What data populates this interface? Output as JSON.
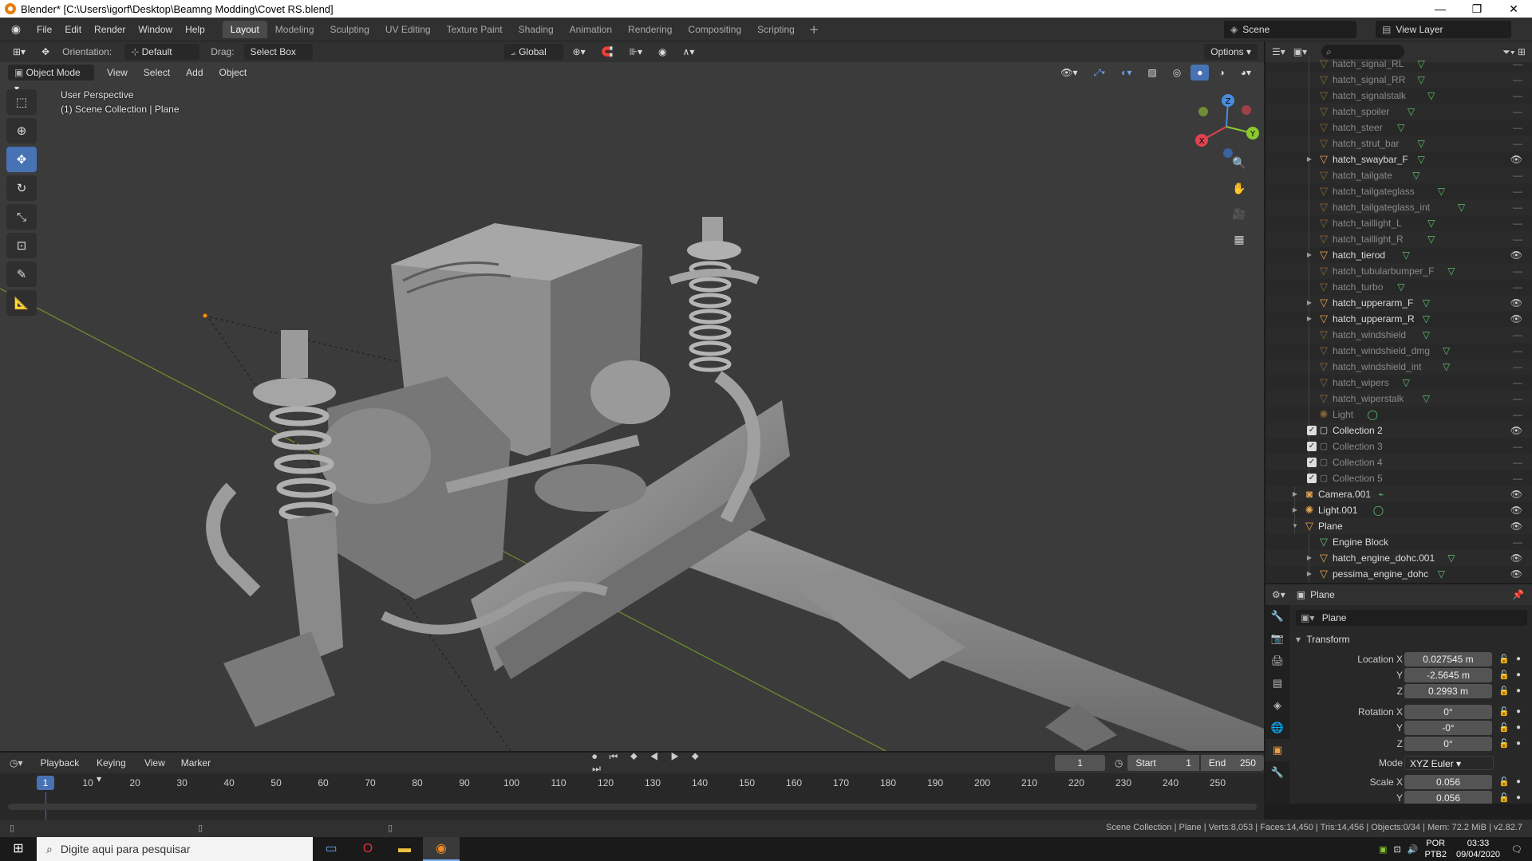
{
  "window": {
    "title": "Blender* [C:\\Users\\igorf\\Desktop\\Beamng Modding\\Covet RS.blend]",
    "controls": [
      "—",
      "❐",
      "✕"
    ]
  },
  "menu": {
    "items": [
      "File",
      "Edit",
      "Render",
      "Window",
      "Help"
    ]
  },
  "workspaces": {
    "tabs": [
      "Layout",
      "Modeling",
      "Sculpting",
      "UV Editing",
      "Texture Paint",
      "Shading",
      "Animation",
      "Rendering",
      "Compositing",
      "Scripting"
    ],
    "active": "Layout"
  },
  "scene": {
    "name": "Scene",
    "view_layer": "View Layer"
  },
  "viewport": {
    "orientation_label": "Orientation:",
    "orientation_value": "Default",
    "drag_label": "Drag:",
    "drag_value": "Select Box",
    "transform_orientation": "Global",
    "options_label": "Options",
    "mode": "Object Mode",
    "menus": [
      "View",
      "Select",
      "Add",
      "Object"
    ],
    "info_line1": "User Perspective",
    "info_line2": "(1) Scene Collection | Plane",
    "gizmo_axes": {
      "x": "X",
      "y": "Y",
      "z": "Z"
    },
    "axis_colors": {
      "x": "#e0434f",
      "y": "#8cc832",
      "z": "#4a8be0",
      "grid_line": "#6b8a2e"
    }
  },
  "outliner": {
    "rows": [
      {
        "name": "hatch_signal_RL",
        "dim": true,
        "eye": false,
        "expandable": false,
        "data": "▽"
      },
      {
        "name": "hatch_signal_RR",
        "dim": true,
        "eye": false,
        "expandable": false,
        "data": "▽"
      },
      {
        "name": "hatch_signalstalk",
        "dim": true,
        "eye": false,
        "expandable": false,
        "data": "▽"
      },
      {
        "name": "hatch_spoiler",
        "dim": true,
        "eye": false,
        "expandable": false,
        "data": "▽"
      },
      {
        "name": "hatch_steer",
        "dim": true,
        "eye": false,
        "expandable": false,
        "data": "▽"
      },
      {
        "name": "hatch_strut_bar",
        "dim": true,
        "eye": false,
        "expandable": false,
        "data": "▽"
      },
      {
        "name": "hatch_swaybar_F",
        "dim": false,
        "eye": true,
        "expandable": true,
        "data": "▽"
      },
      {
        "name": "hatch_tailgate",
        "dim": true,
        "eye": false,
        "expandable": false,
        "data": "▽"
      },
      {
        "name": "hatch_tailgateglass",
        "dim": true,
        "eye": false,
        "expandable": false,
        "data": "▽"
      },
      {
        "name": "hatch_tailgateglass_int",
        "dim": true,
        "eye": false,
        "expandable": false,
        "data": "▽"
      },
      {
        "name": "hatch_taillight_L",
        "dim": true,
        "eye": false,
        "expandable": false,
        "data": "▽"
      },
      {
        "name": "hatch_taillight_R",
        "dim": true,
        "eye": false,
        "expandable": false,
        "data": "▽"
      },
      {
        "name": "hatch_tierod",
        "dim": false,
        "eye": true,
        "expandable": true,
        "data": "▽"
      },
      {
        "name": "hatch_tubularbumper_F",
        "dim": true,
        "eye": false,
        "expandable": false,
        "data": "▽"
      },
      {
        "name": "hatch_turbo",
        "dim": true,
        "eye": false,
        "expandable": false,
        "data": "▽"
      },
      {
        "name": "hatch_upperarm_F",
        "dim": false,
        "eye": true,
        "expandable": true,
        "data": "▽"
      },
      {
        "name": "hatch_upperarm_R",
        "dim": false,
        "eye": true,
        "expandable": true,
        "data": "▽"
      },
      {
        "name": "hatch_windshield",
        "dim": true,
        "eye": false,
        "expandable": false,
        "data": "▽"
      },
      {
        "name": "hatch_windshield_dmg",
        "dim": true,
        "eye": false,
        "expandable": false,
        "data": "▽"
      },
      {
        "name": "hatch_windshield_int",
        "dim": true,
        "eye": false,
        "expandable": false,
        "data": "▽"
      },
      {
        "name": "hatch_wipers",
        "dim": true,
        "eye": false,
        "expandable": false,
        "data": "▽"
      },
      {
        "name": "hatch_wiperstalk",
        "dim": true,
        "eye": false,
        "expandable": false,
        "data": "▽"
      },
      {
        "name": "Light",
        "dim": true,
        "eye": false,
        "expandable": false,
        "data": "◯"
      }
    ],
    "collections": [
      {
        "name": "Collection 2",
        "dim": false,
        "eye": true
      },
      {
        "name": "Collection 3",
        "dim": true,
        "eye": false
      },
      {
        "name": "Collection 4",
        "dim": true,
        "eye": false
      },
      {
        "name": "Collection 5",
        "dim": true,
        "eye": false
      }
    ],
    "objects": [
      {
        "name": "Camera.001",
        "icon": "camera",
        "eye": true,
        "data": "⌁"
      },
      {
        "name": "Light.001",
        "icon": "light",
        "eye": true,
        "data": "◯"
      },
      {
        "name": "Plane",
        "icon": "mesh",
        "eye": true,
        "data": ""
      }
    ],
    "children": [
      {
        "name": "Engine Block",
        "data_only": true,
        "eye": false
      },
      {
        "name": "hatch_engine_dohc.001",
        "data_only": false,
        "eye": true
      },
      {
        "name": "pessima_engine_dohc",
        "data_only": false,
        "eye": true
      }
    ]
  },
  "properties": {
    "object_name": "Plane",
    "datablock": "Plane",
    "panel": "Transform",
    "location_label": "Location X",
    "location": [
      "0.027545 m",
      "-2.5645 m",
      "0.2993 m"
    ],
    "rotation_label": "Rotation X",
    "rotation": [
      "0°",
      "-0°",
      "0°"
    ],
    "axis_labels": [
      "Y",
      "Z"
    ],
    "mode_label": "Mode",
    "mode_value": "XYZ Euler",
    "scale_label": "Scale X",
    "scale": [
      "0.056",
      "0.056"
    ]
  },
  "timeline": {
    "menus": [
      "Playback",
      "Keying",
      "View",
      "Marker"
    ],
    "current_frame": "1",
    "start_label": "Start",
    "start": "1",
    "end_label": "End",
    "end": "250",
    "ticks": [
      "1",
      "10",
      "20",
      "30",
      "40",
      "50",
      "60",
      "70",
      "80",
      "90",
      "100",
      "110",
      "120",
      "130",
      "140",
      "150",
      "160",
      "170",
      "180",
      "190",
      "200",
      "210",
      "220",
      "230",
      "240",
      "250"
    ]
  },
  "status": {
    "text": "Scene Collection | Plane | Verts:8,053 | Faces:14,450 | Tris:14,456 | Objects:0/34 | Mem: 72.2 MiB | v2.82.7"
  },
  "taskbar": {
    "search_placeholder": "Digite aqui para pesquisar",
    "lang1": "POR",
    "lang2": "PTB2",
    "time": "03:33",
    "date": "09/04/2020"
  }
}
